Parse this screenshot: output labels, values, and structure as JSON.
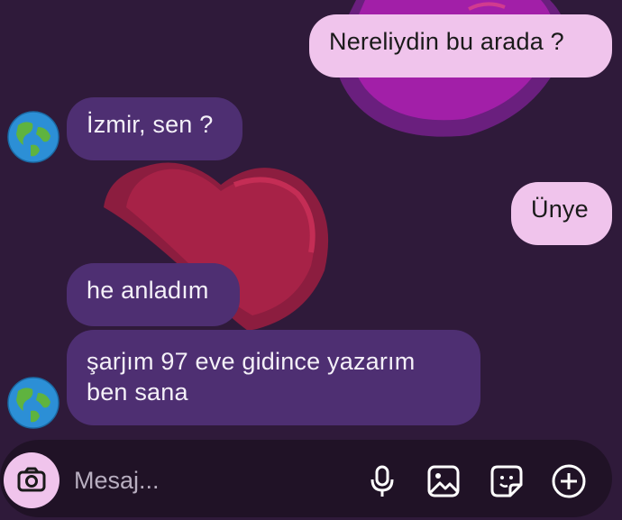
{
  "messages": [
    {
      "direction": "outgoing",
      "text": "Nereliydin bu arada ?"
    },
    {
      "direction": "incoming",
      "text": "İzmir, sen ?"
    },
    {
      "direction": "outgoing",
      "text": "Ünye"
    },
    {
      "direction": "incoming",
      "text": "he anladım"
    },
    {
      "direction": "incoming",
      "text": "şarjım 97 eve gidince yazarım ben sana"
    }
  ],
  "composer": {
    "placeholder": "Mesaj...",
    "icons": [
      "camera-icon",
      "microphone-icon",
      "gallery-icon",
      "sticker-icon",
      "plus-icon"
    ]
  },
  "avatar": {
    "icon": "earth-globe-icon"
  },
  "colors": {
    "background": "#2f1a3a",
    "outgoing_bubble": "#f0c4ec",
    "incoming_bubble": "#4e2f72",
    "composer_bg": "#201226"
  }
}
